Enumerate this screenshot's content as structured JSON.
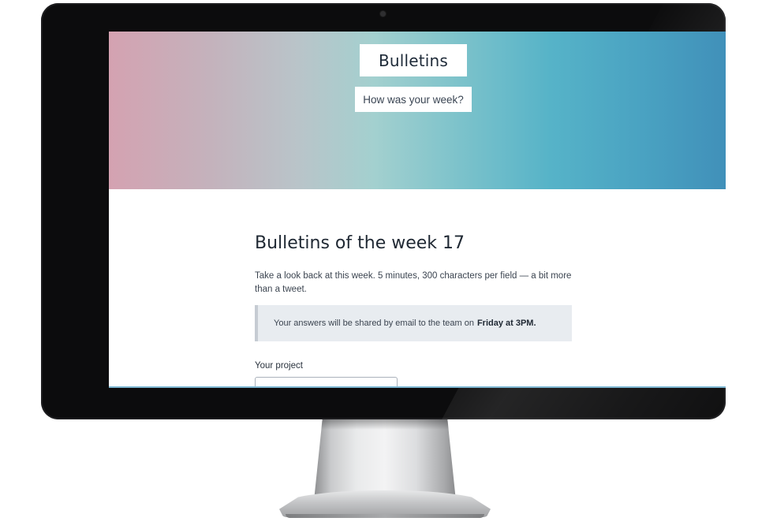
{
  "site": {
    "brand": "Bulletins",
    "tagline": "How was your week?"
  },
  "main": {
    "title": "Bulletins of the week 17",
    "intro": "Take a look back at this week. 5 minutes, 300 characters per field — a bit more than a tweet.",
    "notice": {
      "text": "Your answers will be shared by email to the team on",
      "emphasis": "Friday at 3PM."
    },
    "project_field": {
      "label": "Your project",
      "value": ""
    }
  },
  "colors": {
    "hero_gradient": [
      "#d4a2b1",
      "#a3d0cf",
      "#56b3c8",
      "#3f8db8"
    ],
    "text_primary": "#1f2833",
    "notice_bg": "#e8ecf0",
    "bezel": "#0c0c0d"
  },
  "icons": {
    "camera": "webcam-dot"
  }
}
